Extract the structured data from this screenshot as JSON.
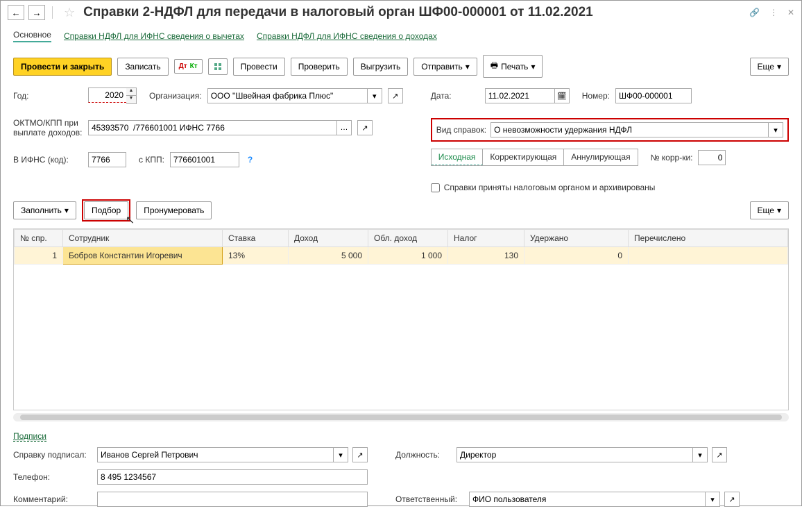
{
  "title": "Справки 2-НДФЛ для передачи в налоговый орган ШФ00-000001 от 11.02.2021",
  "tabs": {
    "main": "Основное",
    "link1": "Справки НДФЛ для ИФНС сведения о вычетах",
    "link2": "Справки НДФЛ для ИФНС сведения о доходах"
  },
  "toolbar": {
    "post_close": "Провести и закрыть",
    "write": "Записать",
    "post": "Провести",
    "check": "Проверить",
    "export": "Выгрузить",
    "send": "Отправить",
    "print": "Печать",
    "more": "Еще"
  },
  "fields": {
    "year_lbl": "Год:",
    "year": "2020",
    "org_lbl": "Организация:",
    "org": "ООО \"Швейная фабрика Плюс\"",
    "date_lbl": "Дата:",
    "date": "11.02.2021",
    "number_lbl": "Номер:",
    "number": "ШФ00-000001",
    "oktmo_lbl": "ОКТМО/КПП при выплате доходов:",
    "oktmo": "45393570  /776601001 ИФНС 7766",
    "kind_lbl": "Вид справок:",
    "kind": "О невозможности удержания НДФЛ",
    "ifns_lbl": "В ИФНС (код):",
    "ifns": "7766",
    "kpp_lbl": "с КПП:",
    "kpp": "776601001",
    "type_source": "Исходная",
    "type_correct": "Корректирующая",
    "type_cancel": "Аннулирующая",
    "korr_lbl": "№ корр-ки:",
    "korr": "0",
    "accepted": "Справки приняты налоговым органом и архивированы"
  },
  "table_toolbar": {
    "fill": "Заполнить",
    "pick": "Подбор",
    "renumber": "Пронумеровать",
    "more": "Еще"
  },
  "table": {
    "headers": {
      "num": "№ спр.",
      "emp": "Сотрудник",
      "rate": "Ставка",
      "income": "Доход",
      "tax_income": "Обл. доход",
      "tax": "Налог",
      "withheld": "Удержано",
      "transferred": "Перечислено"
    },
    "rows": [
      {
        "num": "1",
        "emp": "Бобров Константин Игоревич",
        "rate": "13%",
        "income": "5 000",
        "tax_income": "1 000",
        "tax": "130",
        "withheld": "0",
        "transferred": ""
      }
    ]
  },
  "signatures": {
    "link": "Подписи",
    "signed_lbl": "Справку подписал:",
    "signed": "Иванов Сергей Петрович",
    "position_lbl": "Должность:",
    "position": "Директор",
    "phone_lbl": "Телефон:",
    "phone": "8 495 1234567",
    "comment_lbl": "Комментарий:",
    "comment": "",
    "responsible_lbl": "Ответственный:",
    "responsible": "ФИО пользователя"
  }
}
